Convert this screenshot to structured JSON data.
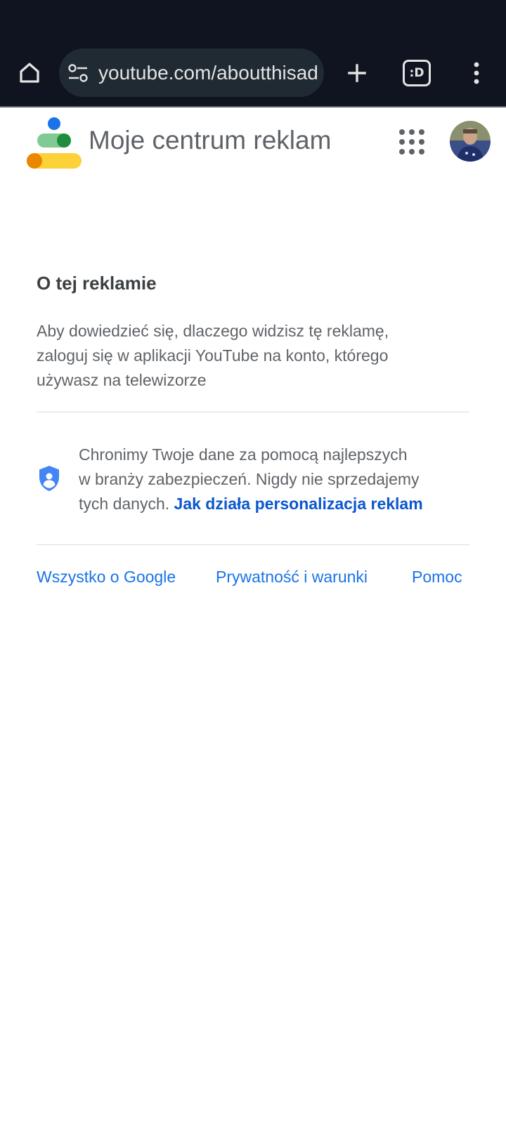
{
  "browser": {
    "home_icon": "home-icon",
    "site_info_icon": "tune-icon",
    "url": "youtube.com/aboutthisad",
    "new_tab_icon": "plus-icon",
    "tab_switcher_label": ":D",
    "menu_icon": "more-vert-icon",
    "background_color": "#0f1420"
  },
  "header": {
    "logo_icon": "my-ad-center-logo",
    "title": "Moje centrum reklam",
    "apps_icon": "apps-grid-icon",
    "avatar_icon": "account-avatar"
  },
  "main": {
    "heading": "O tej reklamie",
    "body_lines": [
      "Aby dowiedzieć się, dlaczego widzisz tę reklamę,",
      "zaloguj się w aplikacji YouTube na konto, którego",
      "używasz na telewizorze"
    ],
    "privacy": {
      "icon": "shield-icon",
      "lines": [
        "Chronimy Twoje dane za pomocą najlepszych",
        "w branży zabezpieczeń. Nigdy nie sprzedajemy",
        "tych danych."
      ],
      "link_label": "Jak działa personalizacja reklam"
    }
  },
  "footer": {
    "links": [
      "Wszystko o Google",
      "Prywatność i warunki",
      "Pomoc"
    ]
  },
  "colors": {
    "link_blue": "#1a73e8",
    "link_bold_blue": "#0b57d0",
    "heading_text": "#3c4043",
    "body_text": "#5f6368",
    "divider": "#dadce0"
  }
}
